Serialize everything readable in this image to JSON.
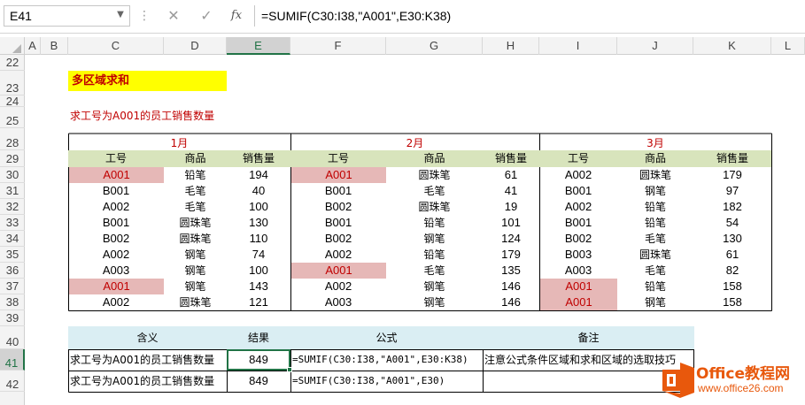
{
  "formula_bar": {
    "name_box": "E41",
    "formula": "=SUMIF(C30:I38,\"A001\",E30:K38)",
    "cancel_icon": "✕",
    "enter_icon": "✓",
    "fx_icon": "fx"
  },
  "columns": [
    "A",
    "B",
    "C",
    "D",
    "E",
    "F",
    "G",
    "H",
    "I",
    "J",
    "K",
    "L"
  ],
  "rows": [
    "22",
    "23",
    "24",
    "25",
    "28",
    "29",
    "30",
    "31",
    "32",
    "33",
    "34",
    "35",
    "36",
    "37",
    "38",
    "39",
    "40",
    "41",
    "42"
  ],
  "sheet": {
    "title": "多区域求和",
    "subtitle": "求工号为A001的员工销售数量",
    "months": [
      "1月",
      "2月",
      "3月"
    ],
    "col_headers": [
      "工号",
      "商品",
      "销售量"
    ],
    "month1": [
      [
        "A001",
        "铅笔",
        "194"
      ],
      [
        "B001",
        "毛笔",
        "40"
      ],
      [
        "A002",
        "毛笔",
        "100"
      ],
      [
        "B001",
        "圆珠笔",
        "130"
      ],
      [
        "B002",
        "圆珠笔",
        "110"
      ],
      [
        "A002",
        "钢笔",
        "74"
      ],
      [
        "A003",
        "钢笔",
        "100"
      ],
      [
        "A001",
        "钢笔",
        "143"
      ],
      [
        "A002",
        "圆珠笔",
        "121"
      ]
    ],
    "month2": [
      [
        "A001",
        "圆珠笔",
        "61"
      ],
      [
        "B001",
        "毛笔",
        "41"
      ],
      [
        "B002",
        "圆珠笔",
        "19"
      ],
      [
        "B001",
        "铅笔",
        "101"
      ],
      [
        "B002",
        "钢笔",
        "124"
      ],
      [
        "A002",
        "铅笔",
        "179"
      ],
      [
        "A001",
        "毛笔",
        "135"
      ],
      [
        "A002",
        "钢笔",
        "146"
      ],
      [
        "A003",
        "钢笔",
        "146"
      ]
    ],
    "month3": [
      [
        "A002",
        "圆珠笔",
        "179"
      ],
      [
        "B001",
        "钢笔",
        "97"
      ],
      [
        "A002",
        "铅笔",
        "182"
      ],
      [
        "B001",
        "铅笔",
        "54"
      ],
      [
        "B002",
        "毛笔",
        "130"
      ],
      [
        "B003",
        "圆珠笔",
        "61"
      ],
      [
        "A003",
        "毛笔",
        "82"
      ],
      [
        "A001",
        "铅笔",
        "158"
      ],
      [
        "A001",
        "钢笔",
        "158"
      ]
    ],
    "result_headers": [
      "含义",
      "结果",
      "公式",
      "备注"
    ],
    "result_rows": [
      [
        "求工号为A001的员工销售数量",
        "849",
        "=SUMIF(C30:I38,\"A001\",E30:K38)",
        "注意公式条件区域和求和区域的选取技巧"
      ],
      [
        "求工号为A001的员工销售数量",
        "849",
        "=SUMIF(C30:I38,\"A001\",E30)",
        ""
      ]
    ]
  },
  "logo": {
    "name": "Office教程网",
    "url": "www.office26.com",
    "color": "#e8580c"
  },
  "colors": {
    "highlight_fill": "#e6b8b7",
    "highlight_text": "#c00000",
    "header_green": "#d8e4bc",
    "header_blue": "#daeef3",
    "title_yellow": "#ffff00",
    "excel_green": "#217346"
  }
}
